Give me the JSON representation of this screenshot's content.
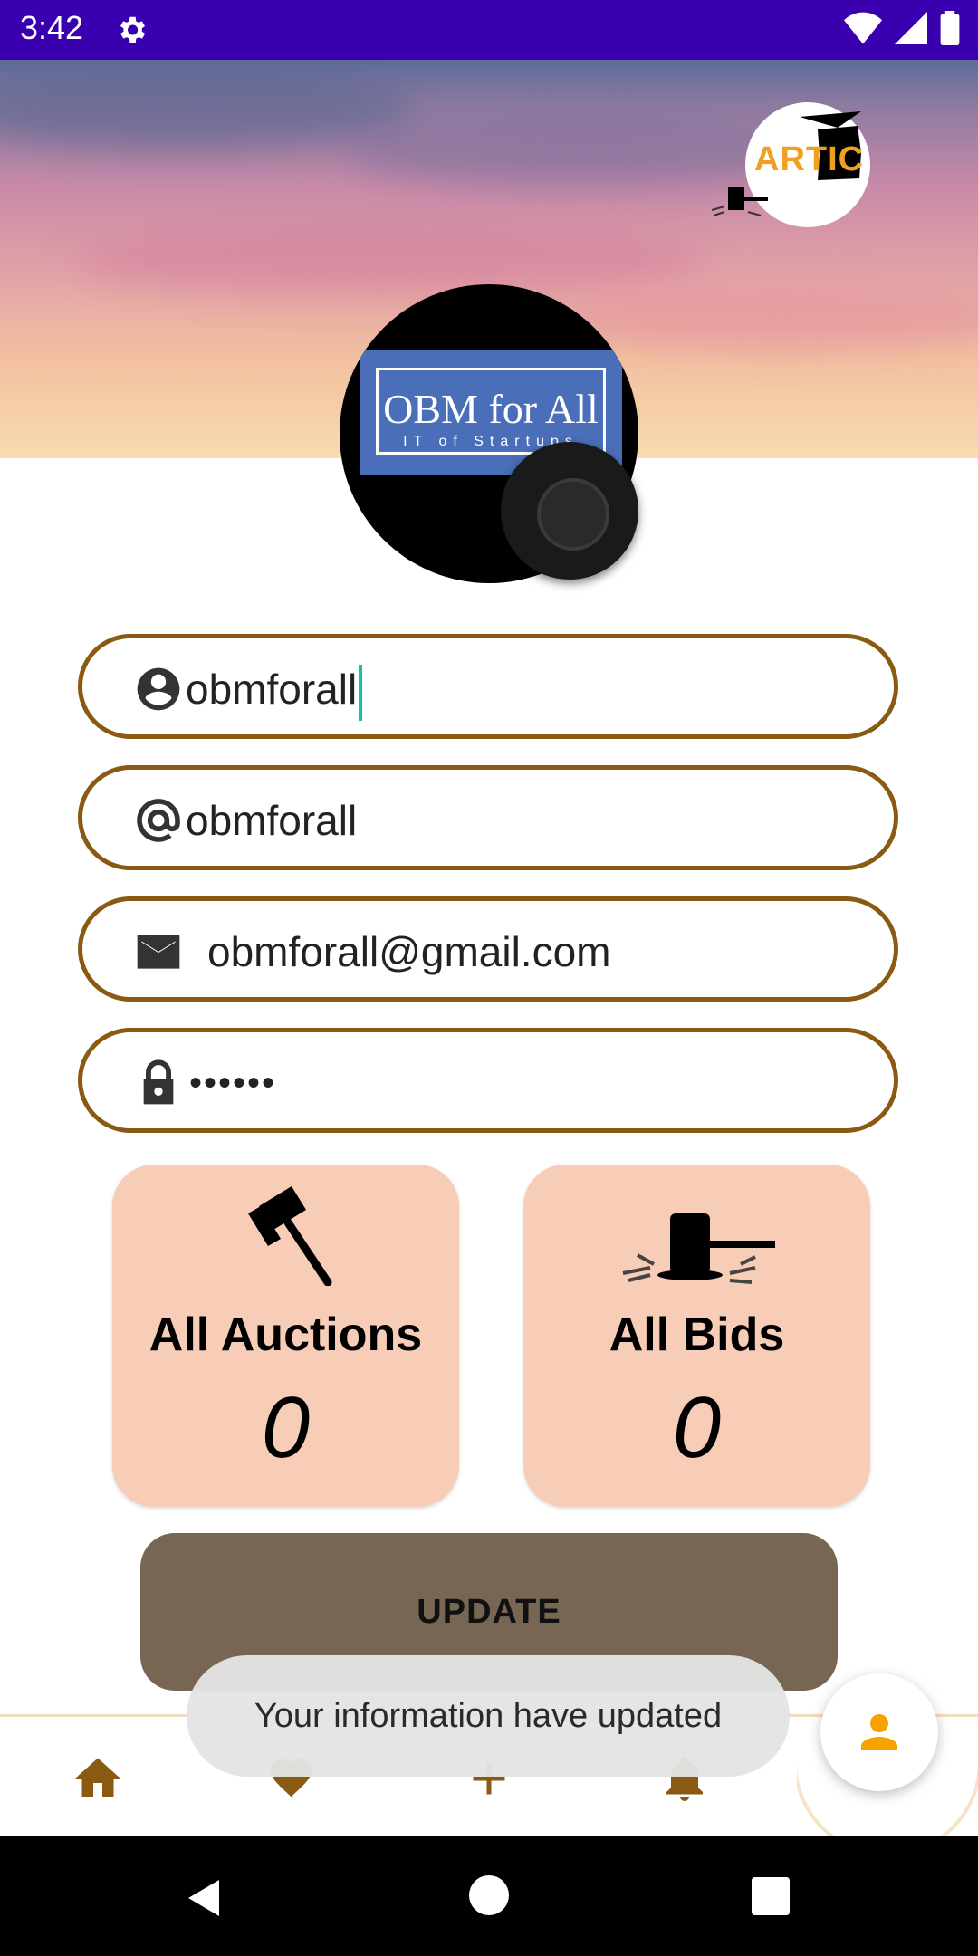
{
  "status_bar": {
    "time": "3:42"
  },
  "branding": {
    "logo_text": "ARTIC"
  },
  "profile": {
    "avatar_title": "OBM for All",
    "avatar_subtitle": "IT of Startups"
  },
  "form": {
    "name_value": "obmforall",
    "username_value": "obmforall",
    "email_value": "obmforall@gmail.com",
    "password_value": "••••••"
  },
  "stats": {
    "auctions": {
      "label": "All Auctions",
      "value": "0"
    },
    "bids": {
      "label": "All Bids",
      "value": "0"
    }
  },
  "update_label": "UPDATE",
  "toast_message": "Your information have updated",
  "colors": {
    "status_bar": "#3a00b0",
    "field_border": "#8a5a12",
    "card_bg": "#f7cdb8",
    "button_bg": "#786654",
    "nav_accent": "#8a5a12",
    "fab_icon": "#f4a300"
  }
}
